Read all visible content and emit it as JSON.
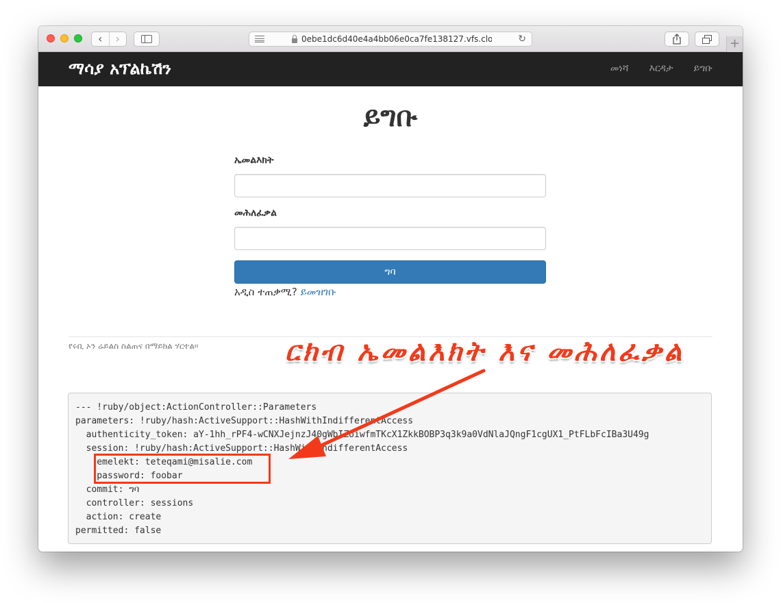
{
  "browser": {
    "url": "0ebe1dc6d40e4a4bb06e0ca7fe138127.vfs.cloud9",
    "back_glyph": "‹",
    "forward_glyph": "›",
    "plus_glyph": "+"
  },
  "navbar": {
    "brand": "ማሳያ አፕልኬሽን",
    "links": [
      "መነሻ",
      "እርዳታ",
      "ይግቡ"
    ]
  },
  "form": {
    "title": "ይግቡ",
    "email_label": "ኤመልእክት",
    "password_label": "መሕለፈቃል",
    "submit_label": "ግባ",
    "signup_prompt": "አዲስ ተጠቃሚ?",
    "signup_link": "ይመዝገቡ"
  },
  "footer": {
    "left": "የሩቢ ኦን ሬይልስ ስልጠና በማይክል ሃርተል።",
    "right": ""
  },
  "debug": {
    "lines": [
      "--- !ruby/object:ActionController::Parameters",
      "parameters: !ruby/hash:ActiveSupport::HashWithIndifferentAccess",
      "  authenticity_token: aY-1hh_rPF4-wCNXJejnzJ40gWbIZoiwfmTKcX1ZkkBOBP3q3k9a0VdNlaJQngF1cgUX1_PtFLbFcIBa3U49g",
      "  session: !ruby/hash:ActiveSupport::HashWithIndifferentAccess",
      "    emelekt: teteqami@misalie.com",
      "    password: foobar",
      "  commit: ግባ",
      "  controller: sessions",
      "  action: create",
      "permitted: false"
    ]
  },
  "annotation": {
    "text": "ርክብ ኤመልእክት እና መሕለፈቃል",
    "color": "#f23a1a"
  },
  "colors": {
    "navbar_bg": "#222222",
    "primary": "#337ab7",
    "link": "#337ab7"
  }
}
